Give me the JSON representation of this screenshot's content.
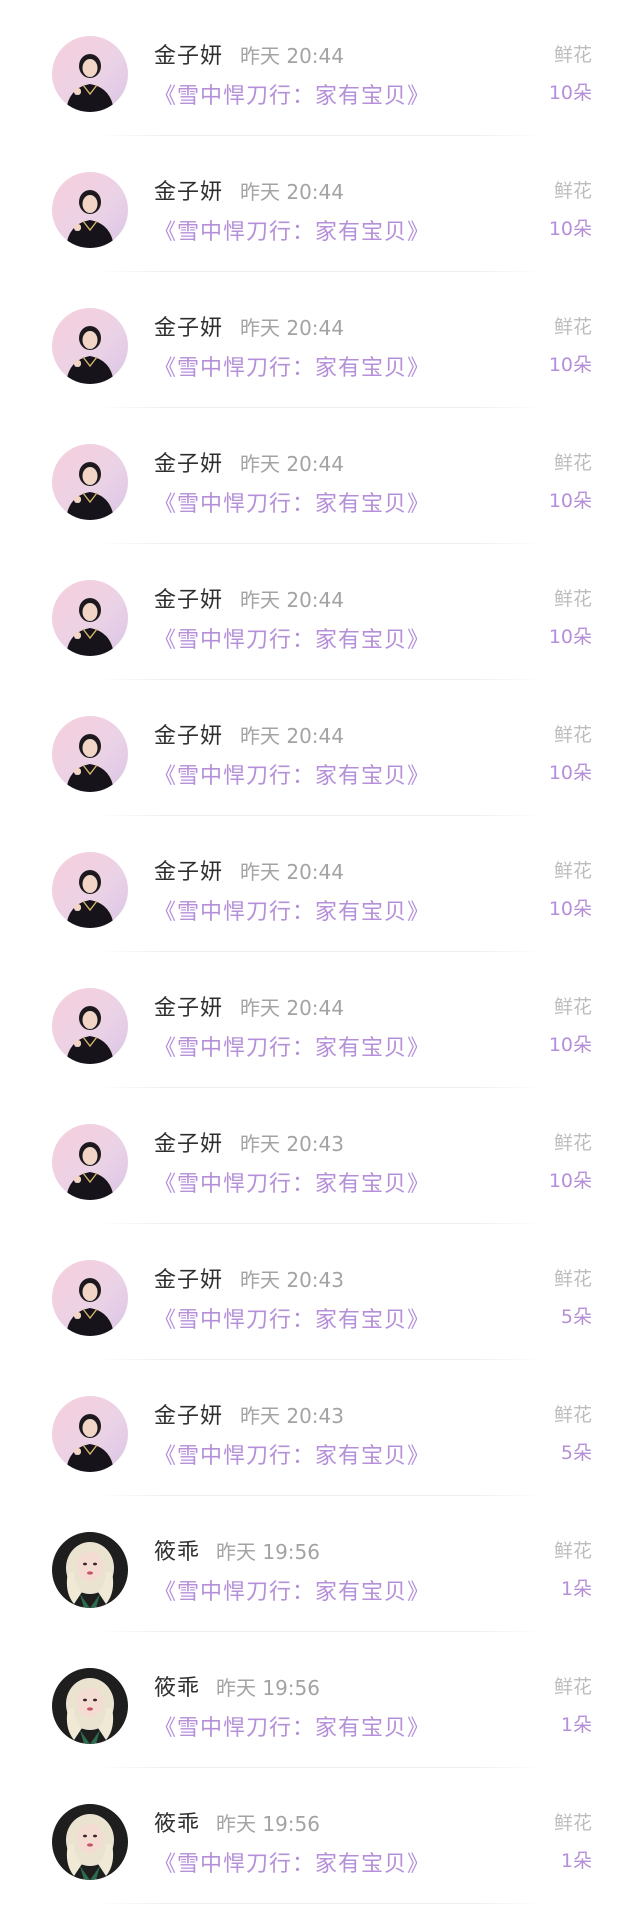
{
  "records": [
    {
      "user": "金子妍",
      "time": "昨天 20:44",
      "book": "《雪中悍刀行：家有宝贝》",
      "gift": "鲜花",
      "count": "10朵",
      "avatar": "pink"
    },
    {
      "user": "金子妍",
      "time": "昨天 20:44",
      "book": "《雪中悍刀行：家有宝贝》",
      "gift": "鲜花",
      "count": "10朵",
      "avatar": "pink"
    },
    {
      "user": "金子妍",
      "time": "昨天 20:44",
      "book": "《雪中悍刀行：家有宝贝》",
      "gift": "鲜花",
      "count": "10朵",
      "avatar": "pink"
    },
    {
      "user": "金子妍",
      "time": "昨天 20:44",
      "book": "《雪中悍刀行：家有宝贝》",
      "gift": "鲜花",
      "count": "10朵",
      "avatar": "pink"
    },
    {
      "user": "金子妍",
      "time": "昨天 20:44",
      "book": "《雪中悍刀行：家有宝贝》",
      "gift": "鲜花",
      "count": "10朵",
      "avatar": "pink"
    },
    {
      "user": "金子妍",
      "time": "昨天 20:44",
      "book": "《雪中悍刀行：家有宝贝》",
      "gift": "鲜花",
      "count": "10朵",
      "avatar": "pink"
    },
    {
      "user": "金子妍",
      "time": "昨天 20:44",
      "book": "《雪中悍刀行：家有宝贝》",
      "gift": "鲜花",
      "count": "10朵",
      "avatar": "pink"
    },
    {
      "user": "金子妍",
      "time": "昨天 20:44",
      "book": "《雪中悍刀行：家有宝贝》",
      "gift": "鲜花",
      "count": "10朵",
      "avatar": "pink"
    },
    {
      "user": "金子妍",
      "time": "昨天 20:43",
      "book": "《雪中悍刀行：家有宝贝》",
      "gift": "鲜花",
      "count": "10朵",
      "avatar": "pink"
    },
    {
      "user": "金子妍",
      "time": "昨天 20:43",
      "book": "《雪中悍刀行：家有宝贝》",
      "gift": "鲜花",
      "count": "5朵",
      "avatar": "pink"
    },
    {
      "user": "金子妍",
      "time": "昨天 20:43",
      "book": "《雪中悍刀行：家有宝贝》",
      "gift": "鲜花",
      "count": "5朵",
      "avatar": "pink"
    },
    {
      "user": "筱乖",
      "time": "昨天 19:56",
      "book": "《雪中悍刀行：家有宝贝》",
      "gift": "鲜花",
      "count": "1朵",
      "avatar": "dark"
    },
    {
      "user": "筱乖",
      "time": "昨天 19:56",
      "book": "《雪中悍刀行：家有宝贝》",
      "gift": "鲜花",
      "count": "1朵",
      "avatar": "dark"
    },
    {
      "user": "筱乖",
      "time": "昨天 19:56",
      "book": "《雪中悍刀行：家有宝贝》",
      "gift": "鲜花",
      "count": "1朵",
      "avatar": "dark"
    }
  ],
  "colors": {
    "name": "#2f2f2f",
    "time": "#a3a3a3",
    "book": "#b58fd8",
    "gift": "#bdbdbd",
    "count": "#b58fd8"
  }
}
